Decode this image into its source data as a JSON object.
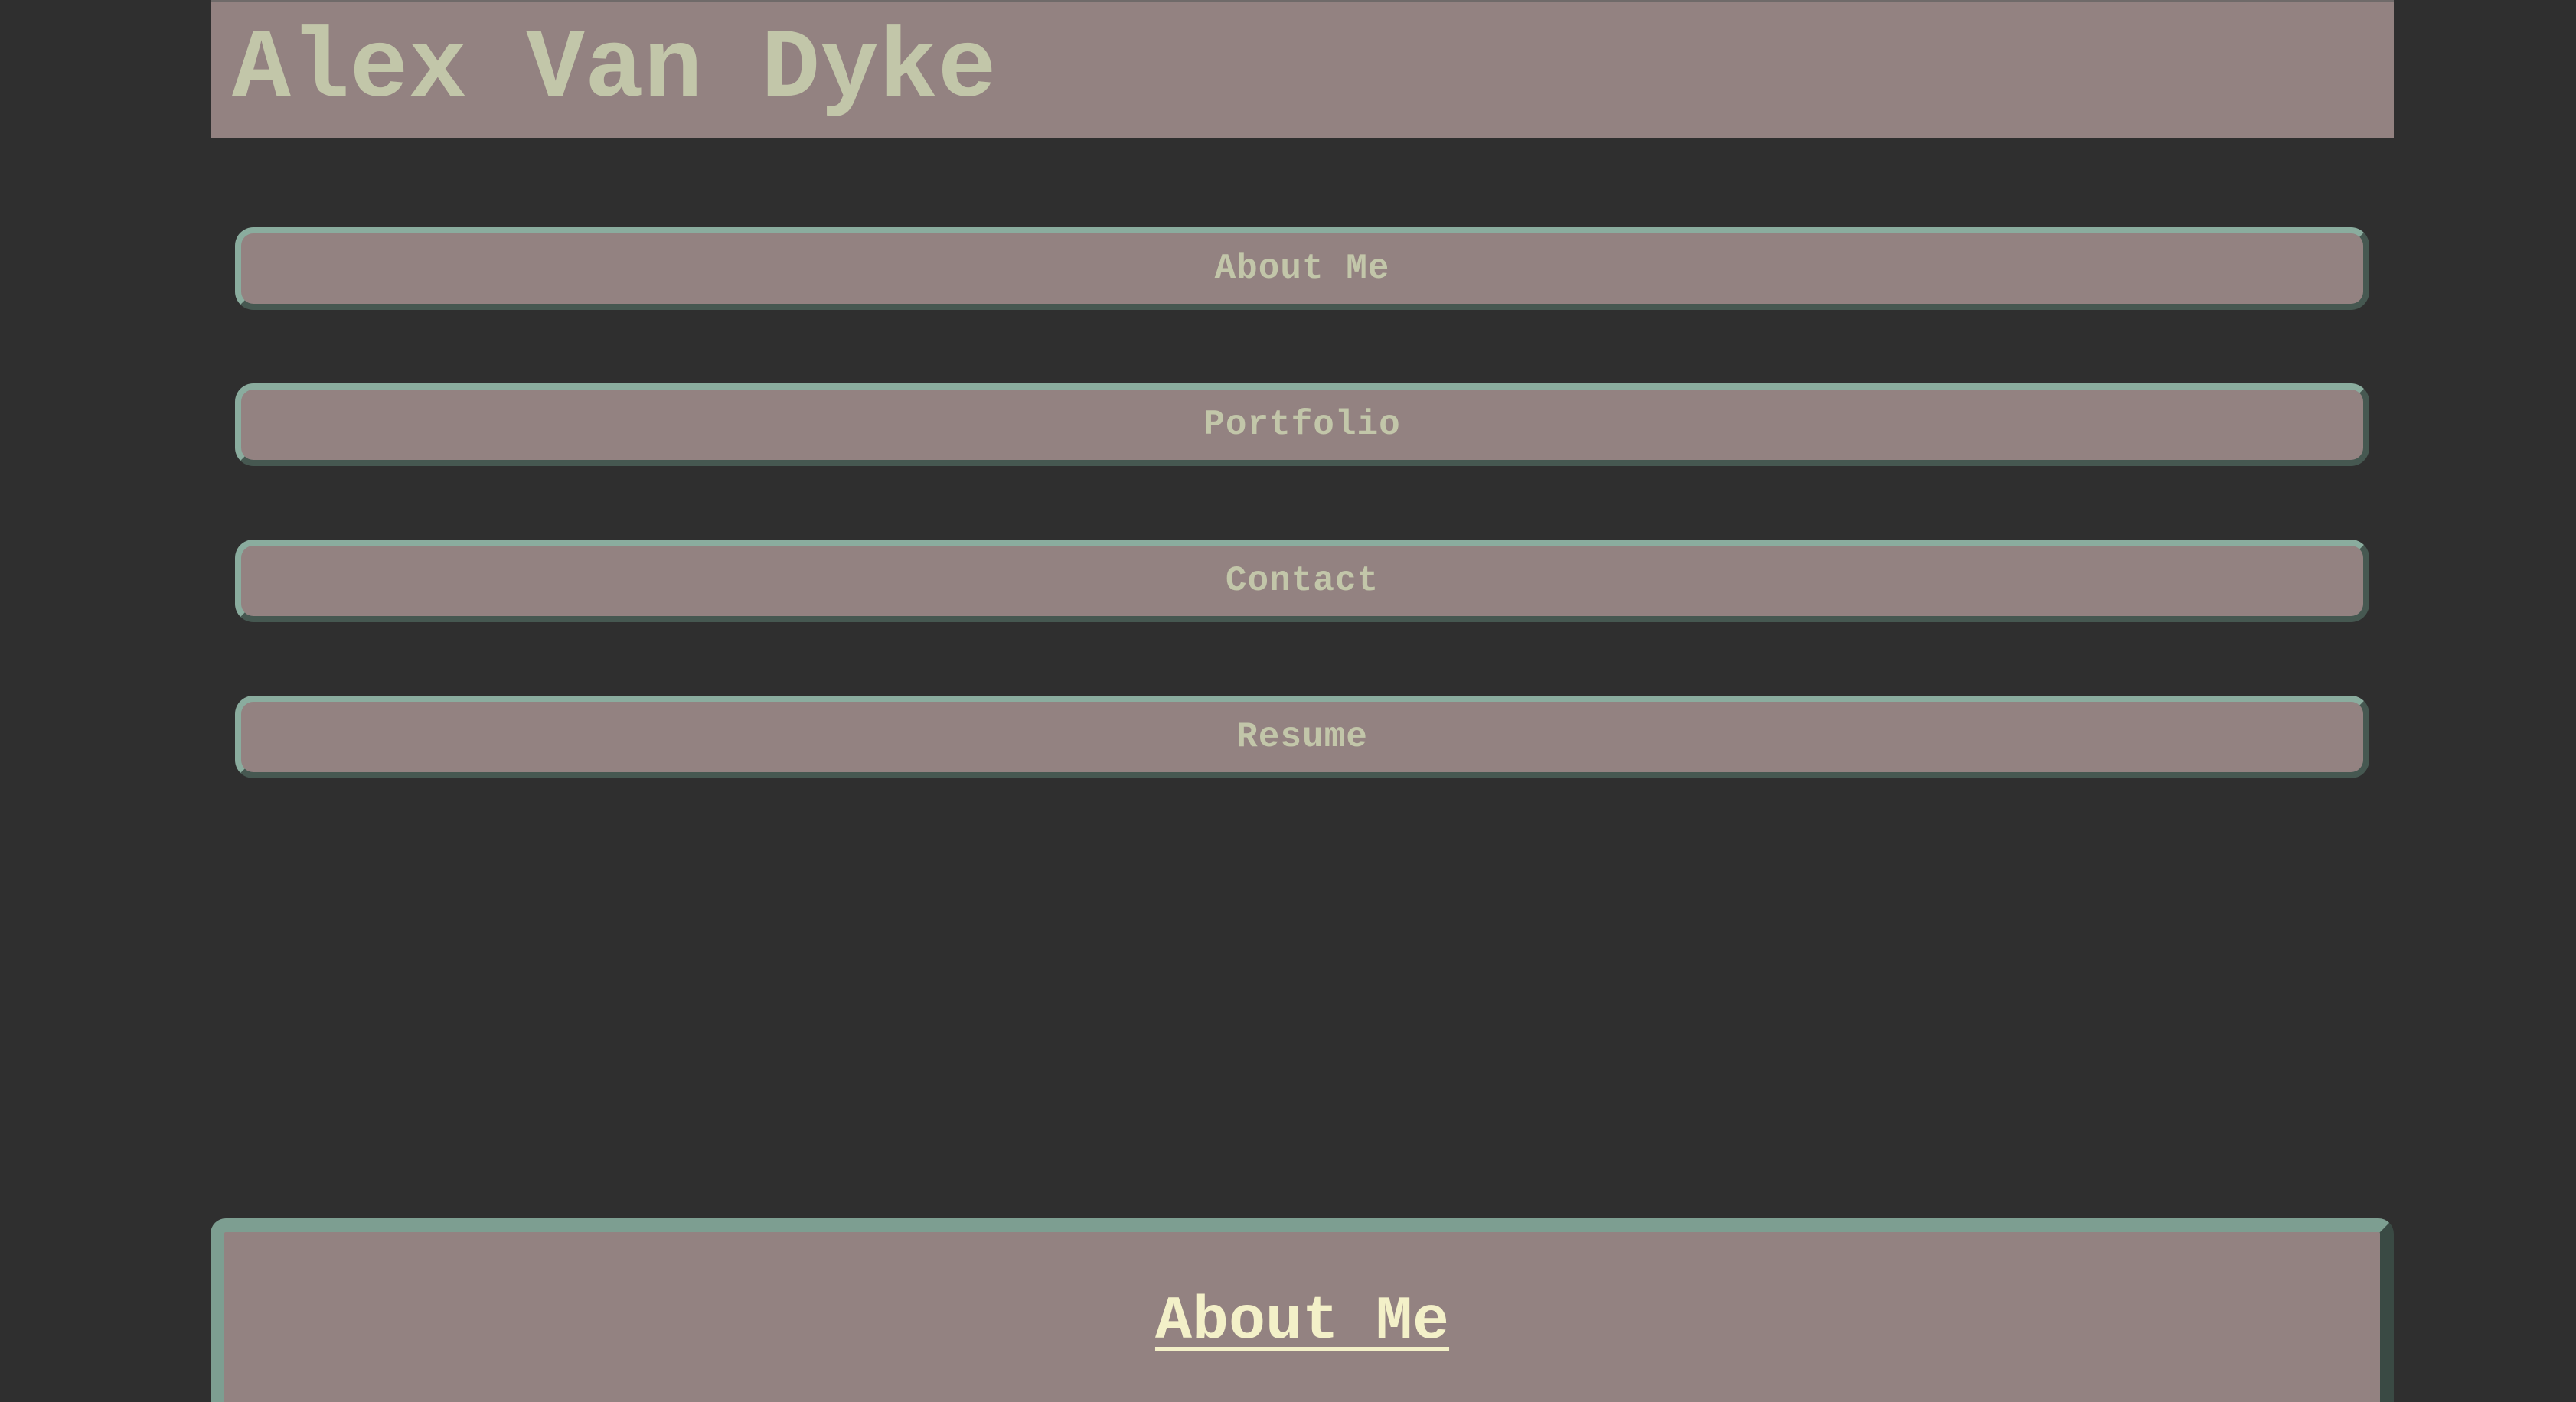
{
  "header": {
    "title": "Alex Van Dyke"
  },
  "nav": {
    "items": [
      {
        "label": "About Me"
      },
      {
        "label": "Portfolio"
      },
      {
        "label": "Contact"
      },
      {
        "label": "Resume"
      }
    ]
  },
  "about": {
    "heading": "About Me"
  },
  "colors": {
    "background": "#2f2f2f",
    "panel": "#938281",
    "border": "#8aac9e",
    "title_text": "#c2c6a9",
    "heading_text": "#f3f0c8"
  }
}
